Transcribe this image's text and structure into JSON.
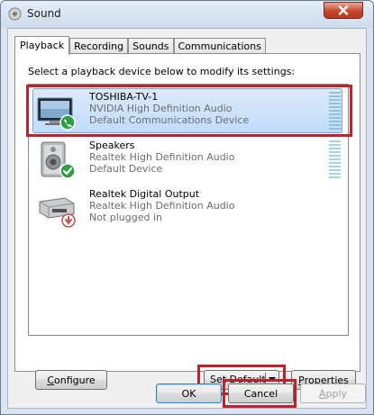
{
  "window": {
    "title": "Sound",
    "icon": "speaker-icon",
    "close_icon": "close-icon"
  },
  "tabs": [
    {
      "label": "Playback",
      "active": true
    },
    {
      "label": "Recording",
      "active": false
    },
    {
      "label": "Sounds",
      "active": false
    },
    {
      "label": "Communications",
      "active": false
    }
  ],
  "panel": {
    "instruction": "Select a playback device below to modify its settings:"
  },
  "devices": [
    {
      "name": "TOSHIBA-TV-1",
      "line1": "NVIDIA High Definition Audio",
      "line2": "Default Communications Device",
      "icon": "tv-monitor-icon",
      "badge": "phone-badge-icon",
      "selected": true
    },
    {
      "name": "Speakers",
      "line1": "Realtek High Definition Audio",
      "line2": "Default Device",
      "icon": "speaker-icon",
      "badge": "checkmark-badge-icon",
      "selected": false
    },
    {
      "name": "Realtek Digital Output",
      "line1": "Realtek High Definition Audio",
      "line2": "Not plugged in",
      "icon": "digital-output-icon",
      "badge": "unplugged-badge-icon",
      "selected": false
    }
  ],
  "buttons": {
    "configure_first": "C",
    "configure_rest": "onfigure",
    "set_default_first": "S",
    "set_default_rest": "et Default",
    "properties_first": "P",
    "properties_rest": "roperties",
    "ok": "OK",
    "cancel": "Cancel",
    "apply_first": "A",
    "apply_rest": "pply"
  },
  "colors": {
    "highlight": "#c2202a",
    "selection": "#c1dcfc",
    "meter": "#9fd7dd"
  }
}
